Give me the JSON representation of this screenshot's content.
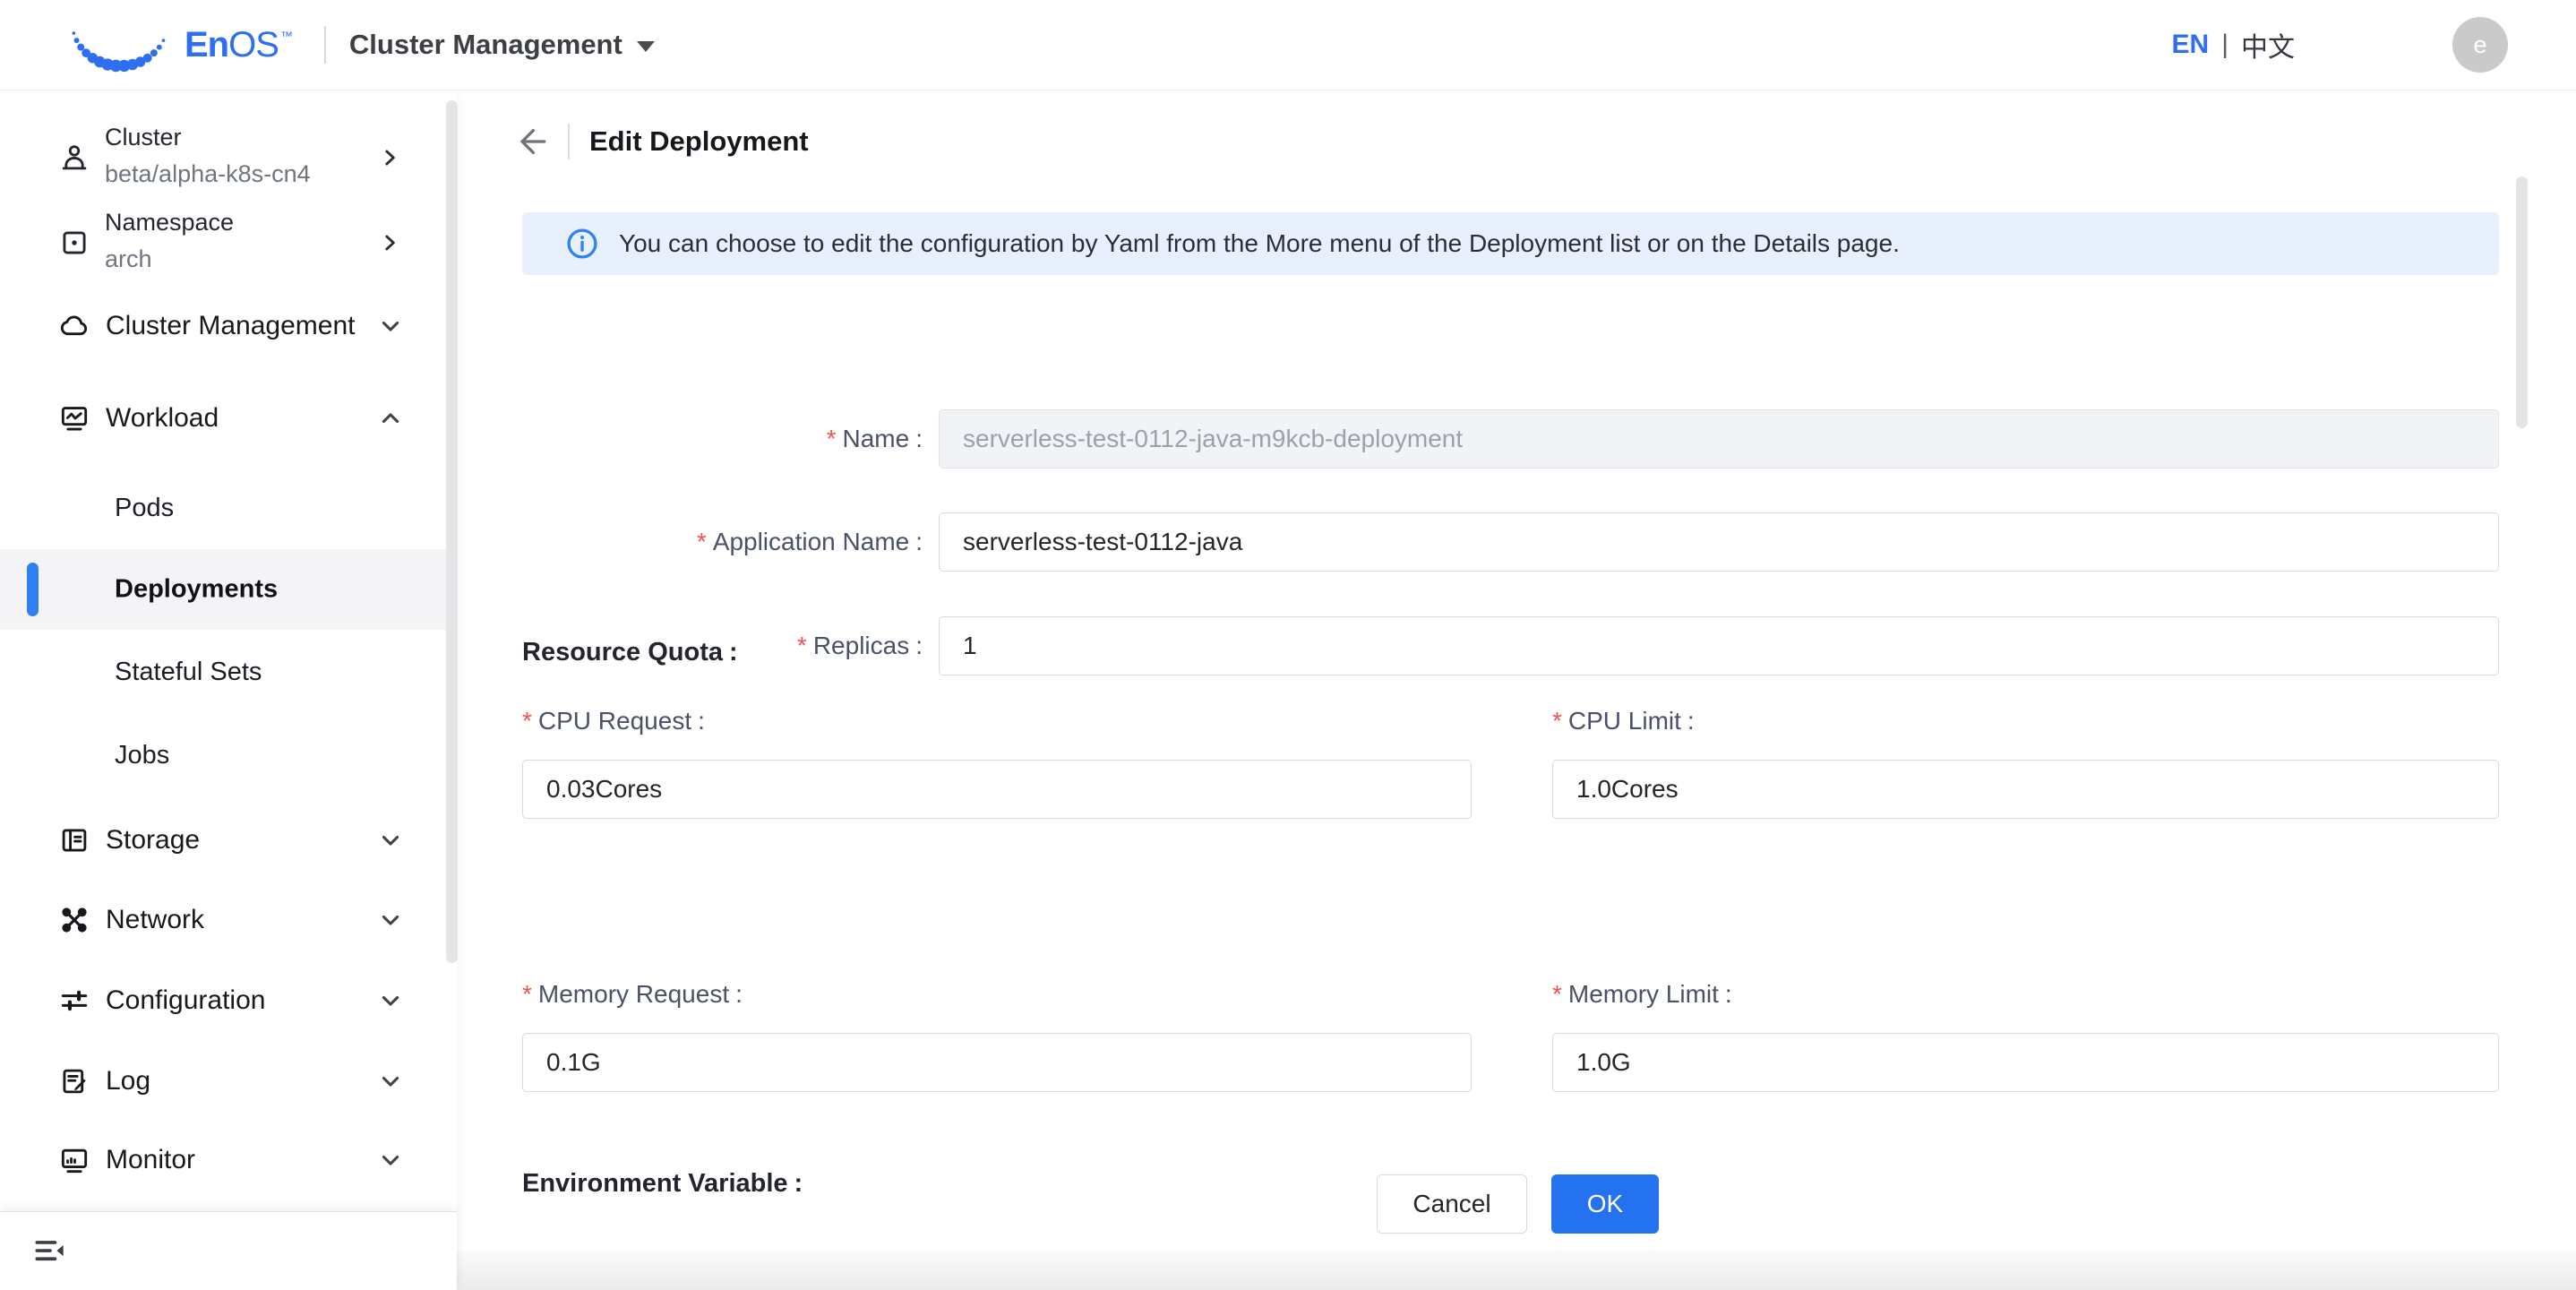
{
  "topbar": {
    "brand_en": "En",
    "brand_os": "OS",
    "brand_tm": "™",
    "app_switcher": "Cluster Management",
    "lang_en": "EN",
    "lang_sep": "|",
    "lang_zh": "中文",
    "avatar_text": "e"
  },
  "sidebar": {
    "context": [
      {
        "label": "Cluster",
        "value": "beta/alpha-k8s-cn4"
      },
      {
        "label": "Namespace",
        "value": "arch"
      }
    ],
    "items": [
      {
        "label": "Cluster Management"
      },
      {
        "label": "Workload"
      },
      {
        "label": "Pods"
      },
      {
        "label": "Deployments"
      },
      {
        "label": "Stateful Sets"
      },
      {
        "label": "Jobs"
      },
      {
        "label": "Storage"
      },
      {
        "label": "Network"
      },
      {
        "label": "Configuration"
      },
      {
        "label": "Log"
      },
      {
        "label": "Monitor"
      }
    ]
  },
  "page": {
    "title": "Edit Deployment",
    "banner_text": "You can choose to edit the configuration by Yaml from the More menu of the Deployment list or on the Details page.",
    "colon": ":",
    "required_mark": "*",
    "sections": {
      "resource_quota": "Resource Quota",
      "environment_variable": "Environment Variable"
    },
    "fields": {
      "name": {
        "label": "Name",
        "value": "serverless-test-0112-java-m9kcb-deployment"
      },
      "application_name": {
        "label": "Application Name",
        "value": "serverless-test-0112-java"
      },
      "replicas": {
        "label": "Replicas",
        "value": "1"
      },
      "cpu_request": {
        "label": "CPU Request",
        "value": "0.03Cores"
      },
      "cpu_limit": {
        "label": "CPU Limit",
        "value": "1.0Cores"
      },
      "memory_request": {
        "label": "Memory Request",
        "value": "0.1G"
      },
      "memory_limit": {
        "label": "Memory Limit",
        "value": "1.0G"
      }
    },
    "buttons": {
      "cancel": "Cancel",
      "ok": "OK"
    }
  },
  "colors": {
    "brand_blue": "#2d6ff0",
    "ok_blue": "#2472ef",
    "banner_bg": "#e9f0fd",
    "required_red": "#f25252",
    "active_item_bg": "#f4f4f6",
    "active_bar_blue": "#2e80f2"
  }
}
